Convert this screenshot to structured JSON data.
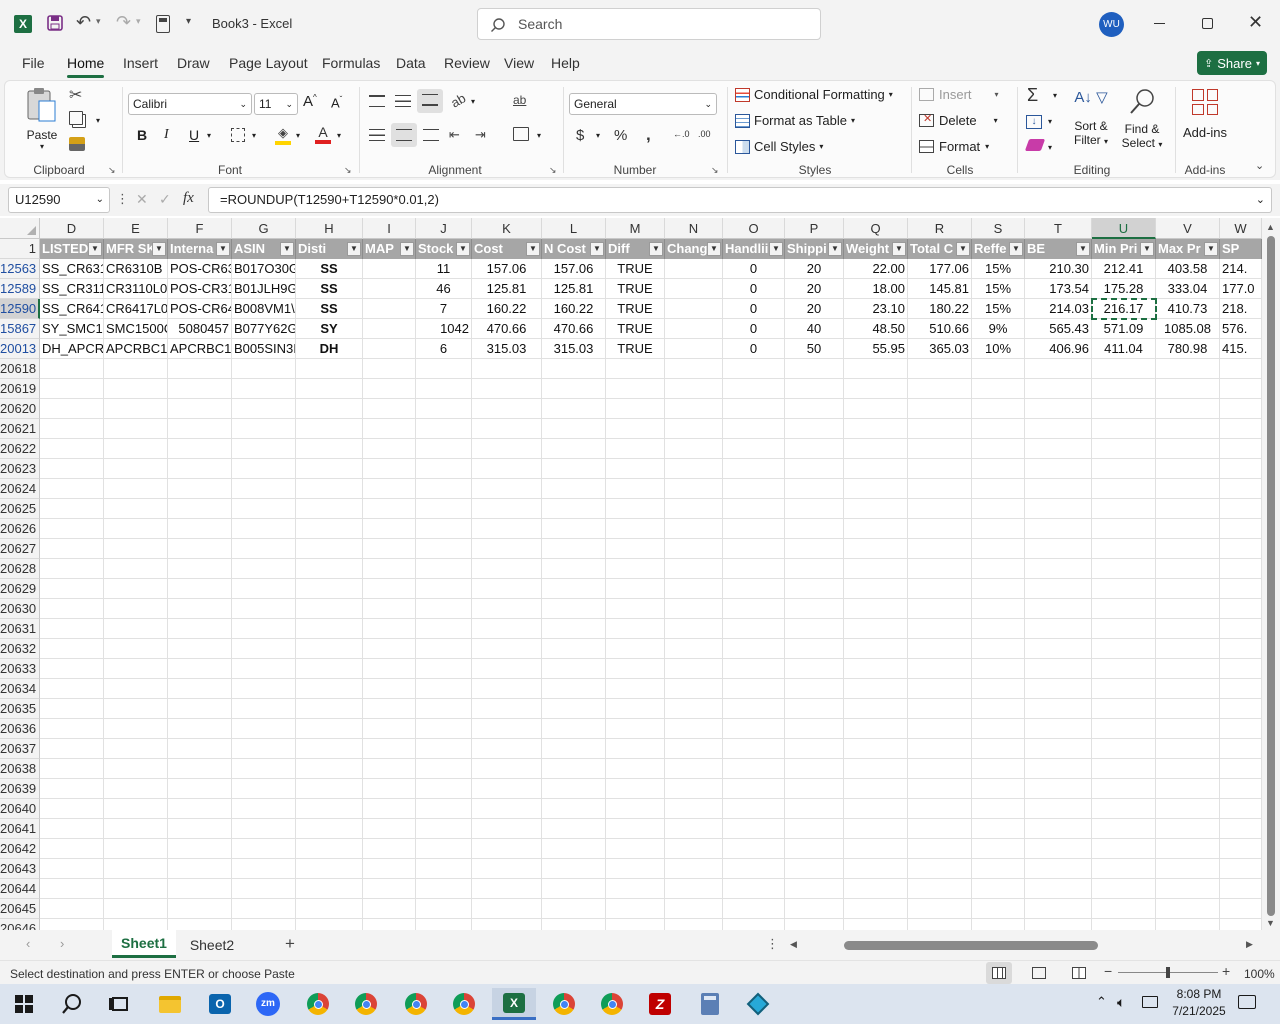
{
  "titlebar": {
    "doc_title": "Book3  -  Excel",
    "search_placeholder": "Search",
    "avatar_initials": "WU"
  },
  "menu": [
    "File",
    "Home",
    "Insert",
    "Draw",
    "Page Layout",
    "Formulas",
    "Data",
    "Review",
    "View",
    "Help"
  ],
  "share_label": "Share",
  "ribbon": {
    "clipboard": {
      "paste": "Paste",
      "label": "Clipboard"
    },
    "font": {
      "name": "Calibri",
      "size": "11",
      "label": "Font"
    },
    "alignment": {
      "label": "Alignment"
    },
    "number": {
      "format": "General",
      "label": "Number"
    },
    "styles": {
      "conditional": "Conditional Formatting",
      "format_table": "Format as Table",
      "cell_styles": "Cell Styles",
      "label": "Styles"
    },
    "cells": {
      "insert": "Insert",
      "delete": "Delete",
      "format": "Format",
      "label": "Cells"
    },
    "editing": {
      "sort_1": "Sort &",
      "sort_2": "Filter",
      "find_1": "Find &",
      "find_2": "Select",
      "label": "Editing"
    },
    "addins": {
      "button": "Add-ins",
      "label": "Add-ins"
    }
  },
  "formula_bar": {
    "name_box": "U12590",
    "formula": "=ROUNDUP(T12590+T12590*0.01,2)"
  },
  "columns": [
    "D",
    "E",
    "F",
    "G",
    "H",
    "I",
    "J",
    "K",
    "L",
    "M",
    "N",
    "O",
    "P",
    "Q",
    "R",
    "S",
    "T",
    "U",
    "V",
    "W"
  ],
  "header_row": {
    "row_number": "1",
    "cells": [
      "LISTED",
      "MFR SK",
      "Interna",
      "ASIN",
      "Disti",
      "MAP",
      "Stock",
      "Cost",
      "N Cost",
      "Diff",
      "Chang",
      "Handlii",
      "Shippi",
      "Weight",
      "Total C",
      "Reffe",
      "BE",
      "Min Pri",
      "Max Pr",
      "SP"
    ]
  },
  "data_rows": [
    {
      "row": "12563",
      "cells": [
        "SS_CR631(",
        "CR6310B",
        "POS-CR63",
        "B017O30G",
        "SS",
        "",
        "11",
        "157.06",
        "157.06",
        "TRUE",
        "",
        "0",
        "20",
        "22.00",
        "177.06",
        "15%",
        "210.30",
        "212.41",
        "403.58",
        "214."
      ]
    },
    {
      "row": "12589",
      "cells": [
        "SS_CR311(",
        "CR3110L01",
        "POS-CR31",
        "B01JLH9GI",
        "SS",
        "",
        "46",
        "125.81",
        "125.81",
        "TRUE",
        "",
        "0",
        "20",
        "18.00",
        "145.81",
        "15%",
        "173.54",
        "175.28",
        "333.04",
        "177.0"
      ]
    },
    {
      "row": "12590",
      "cells": [
        "SS_CR641",
        "CR6417L0",
        "POS-CR64",
        "B008VM1\\",
        "SS",
        "",
        "7",
        "160.22",
        "160.22",
        "TRUE",
        "",
        "0",
        "20",
        "23.10",
        "180.22",
        "15%",
        "214.03",
        "216.17",
        "410.73",
        "218."
      ]
    },
    {
      "row": "15867",
      "cells": [
        "SY_SMC15",
        "SMC1500C",
        "5080457",
        "B077Y62G",
        "SY",
        "",
        "1042",
        "470.66",
        "470.66",
        "TRUE",
        "",
        "0",
        "40",
        "48.50",
        "510.66",
        "9%",
        "565.43",
        "571.09",
        "1085.08",
        "576."
      ]
    },
    {
      "row": "20013",
      "cells": [
        "DH_APCRI",
        "APCRBC11",
        "APCRBC11",
        "B005SIN3I",
        "DH",
        "",
        "6",
        "315.03",
        "315.03",
        "TRUE",
        "",
        "0",
        "50",
        "55.95",
        "365.03",
        "10%",
        "406.96",
        "411.04",
        "780.98",
        "415."
      ]
    }
  ],
  "empty_rows": [
    "20618",
    "20619",
    "20620",
    "20621",
    "20622",
    "20623",
    "20624",
    "20625",
    "20626",
    "20627",
    "20628",
    "20629",
    "20630",
    "20631",
    "20632",
    "20633",
    "20634",
    "20635",
    "20636",
    "20637",
    "20638",
    "20639",
    "20640",
    "20641",
    "20642",
    "20643",
    "20644",
    "20645",
    "20646"
  ],
  "sheets": [
    "Sheet1",
    "Sheet2"
  ],
  "active_sheet": "Sheet1",
  "status": {
    "message": "Select destination and press ENTER or choose Paste",
    "zoom": "100%"
  },
  "taskbar": {
    "time": "8:08 PM",
    "date": "7/21/2025"
  },
  "colors": {
    "excel_green": "#1d6f42",
    "accent_blue": "#2b579a",
    "header_gray": "#a6a6a6"
  }
}
